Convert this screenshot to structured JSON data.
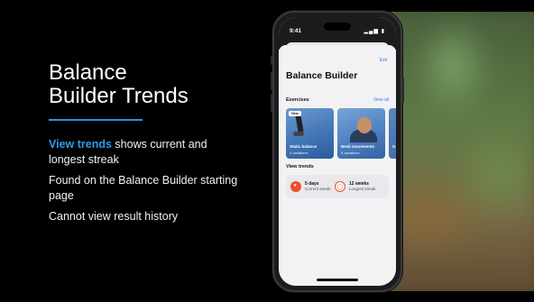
{
  "slide": {
    "title_line1": "Balance",
    "title_line2": "Builder Trends",
    "bullet1_highlight": "View trends",
    "bullet1_rest": " shows current and longest streak",
    "bullet2": "Found on the Balance Builder starting page",
    "bullet3": "Cannot view result history",
    "accent_color": "#2f9de8"
  },
  "phone": {
    "status_time": "9:41",
    "status_icons": "▂▄▆ ▮",
    "exit_label": "Exit",
    "app_title": "Balance Builder",
    "exercises_heading": "Exercises",
    "view_all_label": "View all",
    "cards": [
      {
        "badge": "New",
        "name": "Static balance",
        "sub": "4 variations"
      },
      {
        "badge": "",
        "name": "Neck movements",
        "sub": "6 variations"
      },
      {
        "badge": "",
        "name": "G",
        "sub": ""
      }
    ],
    "trends_heading": "View trends",
    "current_streak_value": "5 days",
    "current_streak_label": "Current streak",
    "longest_streak_value": "12 weeks",
    "longest_streak_label": "Longest streak",
    "icon_current": "flame-icon",
    "icon_longest": "trophy-icon",
    "streak_color": "#ea4f2b"
  }
}
